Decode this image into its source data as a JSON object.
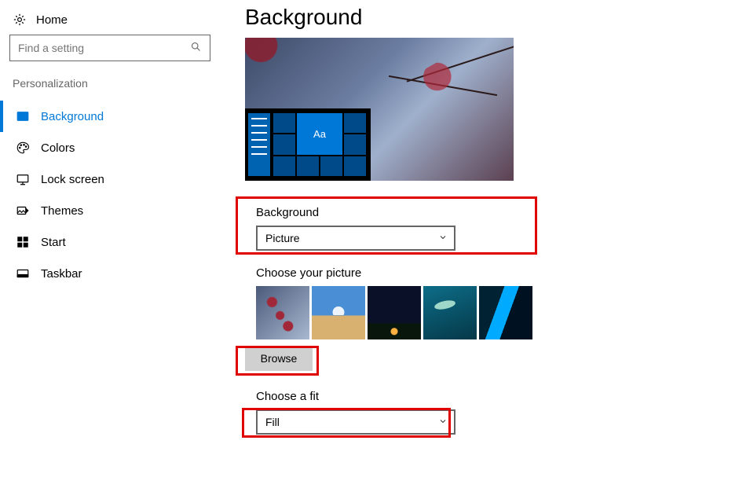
{
  "sidebar": {
    "home_label": "Home",
    "search_placeholder": "Find a setting",
    "section_header": "Personalization",
    "items": [
      {
        "label": "Background"
      },
      {
        "label": "Colors"
      },
      {
        "label": "Lock screen"
      },
      {
        "label": "Themes"
      },
      {
        "label": "Start"
      },
      {
        "label": "Taskbar"
      }
    ]
  },
  "main": {
    "title": "Background",
    "preview_tile_text": "Aa",
    "background_group": {
      "label": "Background",
      "selected": "Picture"
    },
    "picture_group": {
      "label": "Choose your picture",
      "browse_label": "Browse"
    },
    "fit_group": {
      "label": "Choose a fit",
      "selected": "Fill"
    }
  }
}
